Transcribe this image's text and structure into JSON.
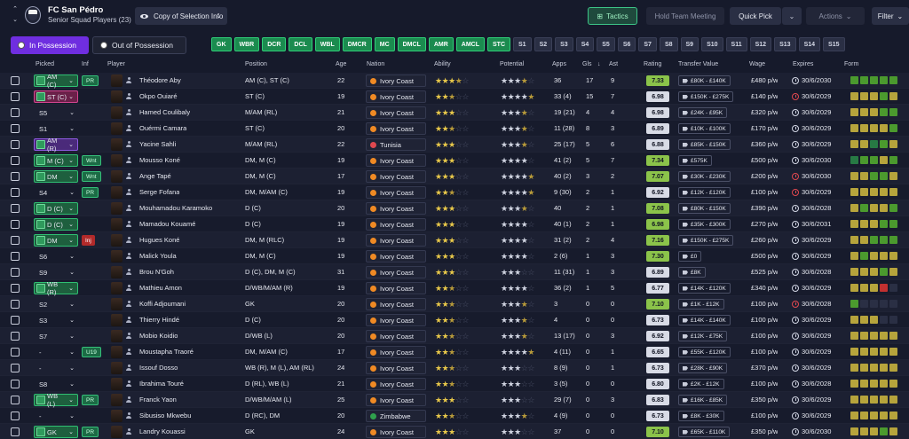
{
  "header": {
    "club_name": "FC San Pédro",
    "squad_label": "Senior Squad Players (23)",
    "view_select": "Copy of Selection Info",
    "tactics_label": "Tactics",
    "team_meeting_label": "Hold Team Meeting",
    "quick_pick_label": "Quick Pick",
    "actions_label": "Actions",
    "filter_label": "Filter"
  },
  "tabs": {
    "in_possession": "In Possession",
    "out_of_possession": "Out of Possession"
  },
  "position_chips": [
    {
      "label": "GK",
      "on": true
    },
    {
      "label": "WBR",
      "on": true
    },
    {
      "label": "DCR",
      "on": true
    },
    {
      "label": "DCL",
      "on": true
    },
    {
      "label": "WBL",
      "on": true
    },
    {
      "label": "DMCR",
      "on": true
    },
    {
      "label": "MC",
      "on": true
    },
    {
      "label": "DMCL",
      "on": true
    },
    {
      "label": "AMR",
      "on": true
    },
    {
      "label": "AMCL",
      "on": true
    },
    {
      "label": "STC",
      "on": true
    },
    {
      "label": "S1",
      "on": false
    },
    {
      "label": "S2",
      "on": false
    },
    {
      "label": "S3",
      "on": false
    },
    {
      "label": "S4",
      "on": false
    },
    {
      "label": "S5",
      "on": false
    },
    {
      "label": "S6",
      "on": false
    },
    {
      "label": "S7",
      "on": false
    },
    {
      "label": "S8",
      "on": false
    },
    {
      "label": "S9",
      "on": false
    },
    {
      "label": "S10",
      "on": false
    },
    {
      "label": "S11",
      "on": false
    },
    {
      "label": "S12",
      "on": false
    },
    {
      "label": "S13",
      "on": false
    },
    {
      "label": "S14",
      "on": false
    },
    {
      "label": "S15",
      "on": false
    }
  ],
  "columns": {
    "picked": "Picked",
    "inf": "Inf",
    "player": "Player",
    "position": "Position",
    "age": "Age",
    "nation": "Nation",
    "ability": "Ability",
    "potential": "Potential",
    "apps": "Apps",
    "gls": "Gls",
    "ast": "Ast",
    "rating": "Rating",
    "transfer_value": "Transfer Value",
    "wage": "Wage",
    "expires": "Expires",
    "form": "Form"
  },
  "colors": {
    "accent": "#6f2ee0",
    "rating_green": "#8bc34a",
    "rating_light": "#d8dbe6",
    "form_good": "#4b9a2e",
    "form_ok": "#b6a43c",
    "form_bad": "#c23030"
  },
  "players": [
    {
      "picked": "AM (C)",
      "pstyle": "green",
      "inf": "PR",
      "name": "Théodore Aby",
      "position": "AM (C), ST (C)",
      "age": "22",
      "nation": "Ivory Coast",
      "flag": "#f08a24",
      "ability": 3.5,
      "potential": 3.5,
      "apps": "36",
      "gls": "17",
      "ast": "9",
      "rating": "7.33",
      "rc": "#8bc34a",
      "tv": "£80K - £140K",
      "wage": "£480 p/w",
      "exp": "30/6/2030",
      "red": false,
      "form": "ggggg"
    },
    {
      "picked": "ST (C)",
      "pstyle": "pink",
      "inf": "",
      "name": "Okpo Ouiaré",
      "position": "ST (C)",
      "age": "19",
      "nation": "Ivory Coast",
      "flag": "#f08a24",
      "ability": 2.5,
      "potential": 4.5,
      "apps": "33 (4)",
      "gls": "15",
      "ast": "7",
      "rating": "6.98",
      "rc": "#d8dbe6",
      "tv": "£150K - £275K",
      "wage": "£140 p/w",
      "exp": "30/6/2029",
      "red": true,
      "form": "yyygy"
    },
    {
      "picked": "S5",
      "pstyle": "plain",
      "inf": "",
      "name": "Hamed Coulibaly",
      "position": "M/AM (RL)",
      "age": "21",
      "nation": "Ivory Coast",
      "flag": "#f08a24",
      "ability": 3,
      "potential": 3.5,
      "apps": "19 (21)",
      "gls": "4",
      "ast": "4",
      "rating": "6.98",
      "rc": "#d8dbe6",
      "tv": "£24K - £95K",
      "wage": "£320 p/w",
      "exp": "30/6/2029",
      "red": false,
      "form": "yyygg"
    },
    {
      "picked": "S1",
      "pstyle": "plain",
      "inf": "",
      "name": "Ouérmi Camara",
      "position": "ST (C)",
      "age": "20",
      "nation": "Ivory Coast",
      "flag": "#f08a24",
      "ability": 2.5,
      "potential": 3.5,
      "apps": "11 (28)",
      "gls": "8",
      "ast": "3",
      "rating": "6.89",
      "rc": "#d8dbe6",
      "tv": "£10K - £100K",
      "wage": "£170 p/w",
      "exp": "30/6/2029",
      "red": false,
      "form": "yyyyg"
    },
    {
      "picked": "AM (R)",
      "pstyle": "purple",
      "inf": "",
      "name": "Yacine Sahli",
      "position": "M/AM (RL)",
      "age": "22",
      "nation": "Tunisia",
      "flag": "#e0484f",
      "ability": 3,
      "potential": 3.5,
      "apps": "25 (17)",
      "gls": "5",
      "ast": "6",
      "rating": "6.88",
      "rc": "#d8dbe6",
      "tv": "£85K - £150K",
      "wage": "£360 p/w",
      "exp": "30/6/2029",
      "red": false,
      "form": "yydgy"
    },
    {
      "picked": "M (C)",
      "pstyle": "green",
      "inf": "Wnt",
      "name": "Mousso Koné",
      "position": "DM, M (C)",
      "age": "19",
      "nation": "Ivory Coast",
      "flag": "#f08a24",
      "ability": 3,
      "potential": 4,
      "apps": "41 (2)",
      "gls": "5",
      "ast": "7",
      "rating": "7.34",
      "rc": "#8bc34a",
      "tv": "£575K",
      "wage": "£500 p/w",
      "exp": "30/6/2030",
      "red": false,
      "form": "dggyg"
    },
    {
      "picked": "DM",
      "pstyle": "green",
      "inf": "Wnt",
      "name": "Ange Tapé",
      "position": "DM, M (C)",
      "age": "17",
      "nation": "Ivory Coast",
      "flag": "#f08a24",
      "ability": 3,
      "potential": 4.5,
      "apps": "40 (2)",
      "gls": "3",
      "ast": "2",
      "rating": "7.07",
      "rc": "#8bc34a",
      "tv": "£30K - £230K",
      "wage": "£200 p/w",
      "exp": "30/6/2030",
      "red": true,
      "form": "yyggy"
    },
    {
      "picked": "S4",
      "pstyle": "plain",
      "inf": "PR",
      "name": "Serge Fofana",
      "position": "DM, M/AM (C)",
      "age": "19",
      "nation": "Ivory Coast",
      "flag": "#f08a24",
      "ability": 2.5,
      "potential": 4.5,
      "apps": "9 (30)",
      "gls": "2",
      "ast": "1",
      "rating": "6.92",
      "rc": "#d8dbe6",
      "tv": "£12K - £120K",
      "wage": "£100 p/w",
      "exp": "30/6/2029",
      "red": true,
      "form": "yyyyy"
    },
    {
      "picked": "D (C)",
      "pstyle": "green",
      "inf": "",
      "name": "Mouhamadou Karamoko",
      "position": "D (C)",
      "age": "20",
      "nation": "Ivory Coast",
      "flag": "#f08a24",
      "ability": 3,
      "potential": 3.5,
      "apps": "40",
      "gls": "2",
      "ast": "1",
      "rating": "7.08",
      "rc": "#8bc34a",
      "tv": "£80K - £150K",
      "wage": "£390 p/w",
      "exp": "30/6/2028",
      "red": false,
      "form": "ygyyg"
    },
    {
      "picked": "D (C)",
      "pstyle": "green",
      "inf": "",
      "name": "Mamadou Kouamé",
      "position": "D (C)",
      "age": "19",
      "nation": "Ivory Coast",
      "flag": "#f08a24",
      "ability": 3,
      "potential": 4,
      "apps": "40 (1)",
      "gls": "2",
      "ast": "1",
      "rating": "6.98",
      "rc": "#8bc34a",
      "tv": "£35K - £300K",
      "wage": "£270 p/w",
      "exp": "30/6/2031",
      "red": false,
      "form": "yyygg"
    },
    {
      "picked": "DM",
      "pstyle": "green",
      "inf": "Inj",
      "name": "Hugues Koné",
      "position": "DM, M (RLC)",
      "age": "19",
      "nation": "Ivory Coast",
      "flag": "#f08a24",
      "ability": 3,
      "potential": 4,
      "apps": "31 (2)",
      "gls": "2",
      "ast": "4",
      "rating": "7.16",
      "rc": "#8bc34a",
      "tv": "£150K - £275K",
      "wage": "£260 p/w",
      "exp": "30/6/2029",
      "red": false,
      "form": "yyggg"
    },
    {
      "picked": "S6",
      "pstyle": "plain",
      "inf": "",
      "name": "Malick Youla",
      "position": "DM, M (C)",
      "age": "19",
      "nation": "Ivory Coast",
      "flag": "#f08a24",
      "ability": 3,
      "potential": 4,
      "apps": "2 (6)",
      "gls": "1",
      "ast": "3",
      "rating": "7.30",
      "rc": "#8bc34a",
      "tv": "£0",
      "wage": "£500 p/w",
      "exp": "30/6/2029",
      "red": false,
      "form": "ygyyy"
    },
    {
      "picked": "S9",
      "pstyle": "plain",
      "inf": "",
      "name": "Brou N'Goh",
      "position": "D (C), DM, M (C)",
      "age": "31",
      "nation": "Ivory Coast",
      "flag": "#f08a24",
      "ability": 3,
      "potential": 3,
      "apps": "11 (31)",
      "gls": "1",
      "ast": "3",
      "rating": "6.89",
      "rc": "#d8dbe6",
      "tv": "£8K",
      "wage": "£525 p/w",
      "exp": "30/6/2028",
      "red": false,
      "form": "yyygy"
    },
    {
      "picked": "WB (R)",
      "pstyle": "green",
      "inf": "",
      "name": "Mathieu Amon",
      "position": "D/WB/M/AM (R)",
      "age": "19",
      "nation": "Ivory Coast",
      "flag": "#f08a24",
      "ability": 2.5,
      "potential": 4,
      "apps": "36 (2)",
      "gls": "1",
      "ast": "5",
      "rating": "6.77",
      "rc": "#d8dbe6",
      "tv": "£14K - £120K",
      "wage": "£340 p/w",
      "exp": "30/6/2029",
      "red": false,
      "form": "yyyrn"
    },
    {
      "picked": "S2",
      "pstyle": "plain",
      "inf": "",
      "name": "Koffi Adjoumani",
      "position": "GK",
      "age": "20",
      "nation": "Ivory Coast",
      "flag": "#f08a24",
      "ability": 2.5,
      "potential": 3.5,
      "apps": "3",
      "gls": "0",
      "ast": "0",
      "rating": "7.10",
      "rc": "#8bc34a",
      "tv": "£1K - £12K",
      "wage": "£100 p/w",
      "exp": "30/6/2028",
      "red": true,
      "form": "gnnnn"
    },
    {
      "picked": "S3",
      "pstyle": "plain",
      "inf": "",
      "name": "Thierry Hindé",
      "position": "D (C)",
      "age": "20",
      "nation": "Ivory Coast",
      "flag": "#f08a24",
      "ability": 2.5,
      "potential": 3.5,
      "apps": "4",
      "gls": "0",
      "ast": "0",
      "rating": "6.73",
      "rc": "#d8dbe6",
      "tv": "£14K - £140K",
      "wage": "£100 p/w",
      "exp": "30/6/2029",
      "red": false,
      "form": "yyynn"
    },
    {
      "picked": "S7",
      "pstyle": "plain",
      "inf": "",
      "name": "Mobio Koidio",
      "position": "D/WB (L)",
      "age": "20",
      "nation": "Ivory Coast",
      "flag": "#f08a24",
      "ability": 2.5,
      "potential": 3.5,
      "apps": "13 (17)",
      "gls": "0",
      "ast": "3",
      "rating": "6.92",
      "rc": "#d8dbe6",
      "tv": "£12K - £75K",
      "wage": "£100 p/w",
      "exp": "30/6/2029",
      "red": false,
      "form": "yyyyy"
    },
    {
      "picked": "-",
      "pstyle": "plain",
      "inf": "U19",
      "name": "Moustapha Traoré",
      "position": "DM, M/AM (C)",
      "age": "17",
      "nation": "Ivory Coast",
      "flag": "#f08a24",
      "ability": 2.5,
      "potential": 4.5,
      "apps": "4 (11)",
      "gls": "0",
      "ast": "1",
      "rating": "6.65",
      "rc": "#d8dbe6",
      "tv": "£55K - £120K",
      "wage": "£100 p/w",
      "exp": "30/6/2029",
      "red": false,
      "form": "yyyyy"
    },
    {
      "picked": "-",
      "pstyle": "plain",
      "inf": "",
      "name": "Issouf Dosso",
      "position": "WB (R), M (L), AM (RL)",
      "age": "24",
      "nation": "Ivory Coast",
      "flag": "#f08a24",
      "ability": 2.5,
      "potential": 3,
      "apps": "8 (9)",
      "gls": "0",
      "ast": "1",
      "rating": "6.73",
      "rc": "#d8dbe6",
      "tv": "£28K - £90K",
      "wage": "£370 p/w",
      "exp": "30/6/2029",
      "red": false,
      "form": "yyyyy"
    },
    {
      "picked": "S8",
      "pstyle": "plain",
      "inf": "",
      "name": "Ibrahima Touré",
      "position": "D (RL), WB (L)",
      "age": "21",
      "nation": "Ivory Coast",
      "flag": "#f08a24",
      "ability": 2.5,
      "potential": 3,
      "apps": "3 (5)",
      "gls": "0",
      "ast": "0",
      "rating": "6.80",
      "rc": "#d8dbe6",
      "tv": "£2K - £12K",
      "wage": "£100 p/w",
      "exp": "30/6/2028",
      "red": false,
      "form": "yyyyy"
    },
    {
      "picked": "WB (L)",
      "pstyle": "green",
      "inf": "PR",
      "name": "Franck Yaon",
      "position": "D/WB/M/AM (L)",
      "age": "25",
      "nation": "Ivory Coast",
      "flag": "#f08a24",
      "ability": 3,
      "potential": 3,
      "apps": "29 (7)",
      "gls": "0",
      "ast": "3",
      "rating": "6.83",
      "rc": "#d8dbe6",
      "tv": "£16K - £85K",
      "wage": "£350 p/w",
      "exp": "30/6/2029",
      "red": false,
      "form": "yyyyy"
    },
    {
      "picked": "-",
      "pstyle": "plain",
      "inf": "",
      "name": "Sibusiso Mkwebu",
      "position": "D (RC), DM",
      "age": "20",
      "nation": "Zimbabwe",
      "flag": "#2fa14d",
      "ability": 2.5,
      "potential": 3.5,
      "apps": "4 (9)",
      "gls": "0",
      "ast": "0",
      "rating": "6.73",
      "rc": "#d8dbe6",
      "tv": "£8K - £30K",
      "wage": "£100 p/w",
      "exp": "30/6/2029",
      "red": false,
      "form": "yyyyy"
    },
    {
      "picked": "GK",
      "pstyle": "green",
      "inf": "PR",
      "name": "Landry Kouassi",
      "position": "GK",
      "age": "24",
      "nation": "Ivory Coast",
      "flag": "#f08a24",
      "ability": 3,
      "potential": 3,
      "apps": "37",
      "gls": "0",
      "ast": "0",
      "rating": "7.10",
      "rc": "#8bc34a",
      "tv": "£65K - £110K",
      "wage": "£350 p/w",
      "exp": "30/6/2030",
      "red": false,
      "form": "yyygy"
    }
  ]
}
